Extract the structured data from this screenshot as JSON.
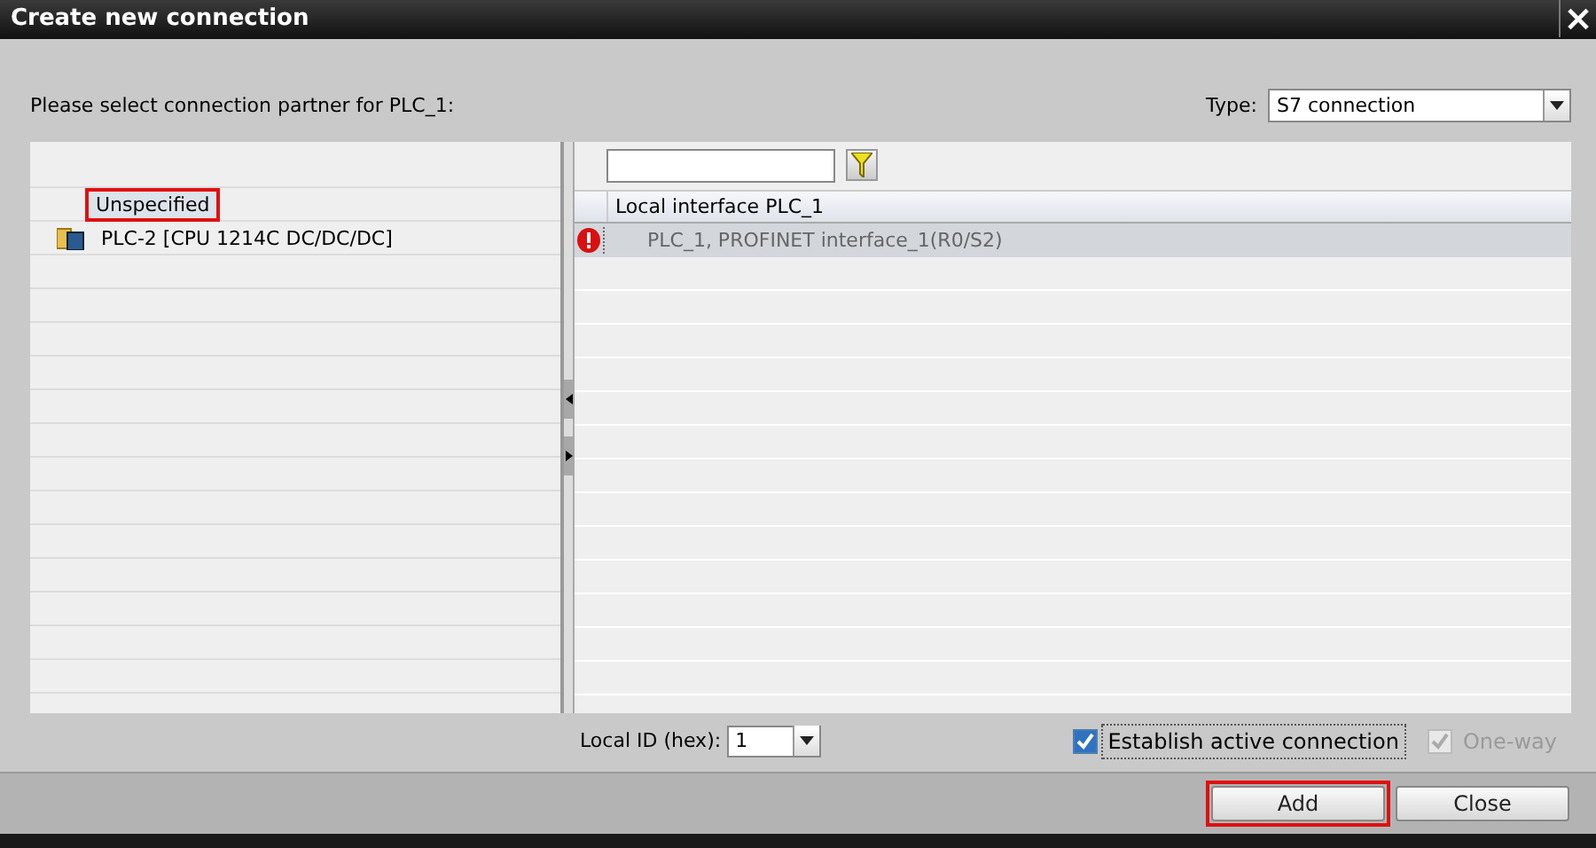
{
  "window": {
    "title": "Create new connection",
    "close": "×"
  },
  "prompt": "Please select connection partner for PLC_1:",
  "type": {
    "label": "Type:",
    "value": "S7 connection"
  },
  "partners": [
    {
      "label": "Unspecified",
      "kind": "header",
      "highlighted": true
    },
    {
      "label": "PLC-2 [CPU 1214C DC/DC/DC]",
      "kind": "device",
      "highlighted": false
    }
  ],
  "table": {
    "column": "Local interface PLC_1",
    "rows": [
      {
        "text": "PLC_1, PROFINET interface_1(R0/S2)",
        "error": true,
        "selected": true
      }
    ]
  },
  "local_id": {
    "label": "Local ID (hex):",
    "value": "1"
  },
  "options": [
    {
      "label": "Establish active connection",
      "checked": true,
      "disabled": false,
      "focused": true
    },
    {
      "label": "One-way",
      "checked": true,
      "disabled": true,
      "focused": false
    }
  ],
  "buttons": [
    {
      "label": "Add",
      "highlighted": true
    },
    {
      "label": "Close",
      "highlighted": false
    }
  ]
}
